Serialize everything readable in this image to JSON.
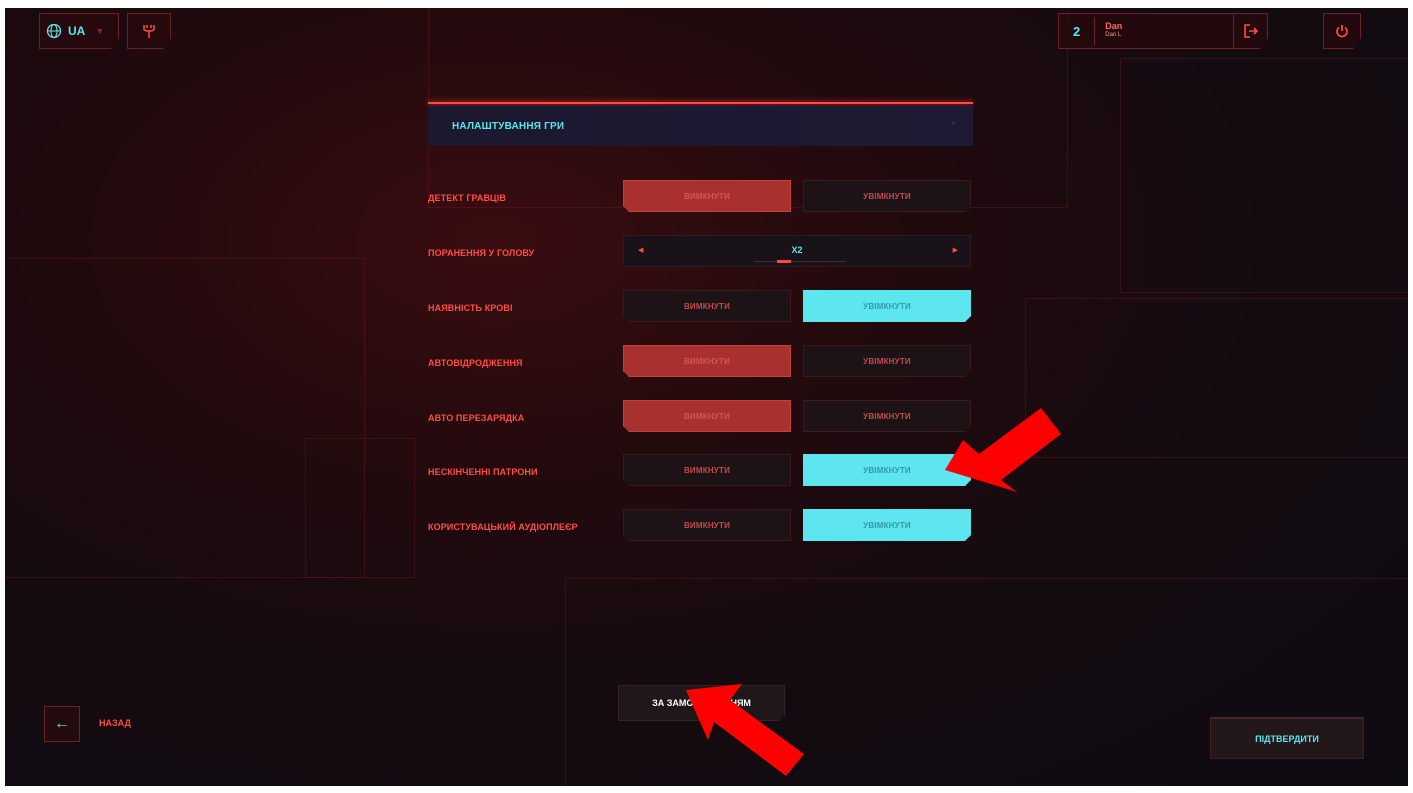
{
  "top_left": {
    "language_code": "UA"
  },
  "top_right": {
    "level": "2",
    "user_name": "Dan",
    "user_subname": "Dan L"
  },
  "section": {
    "title": "НАЛАШТУВАННЯ ГРИ"
  },
  "settings": [
    {
      "label": "ДЕТЕКТ ГРАВЦІВ",
      "off_label": "ВИМКНУТИ",
      "on_label": "УВІМКНУТИ",
      "selected": "off"
    },
    {
      "label": "ПОРАНЕННЯ У ГОЛОВУ",
      "stepper_value": "X2"
    },
    {
      "label": "НАЯВНІСТЬ КРОВІ",
      "off_label": "ВИМКНУТИ",
      "on_label": "УВІМКНУТИ",
      "selected": "on"
    },
    {
      "label": "АВТОВІДРОДЖЕННЯ",
      "off_label": "ВИМКНУТИ",
      "on_label": "УВІМКНУТИ",
      "selected": "off"
    },
    {
      "label": "АВТО ПЕРЕЗАРЯДКА",
      "off_label": "ВИМКНУТИ",
      "on_label": "УВІМКНУТИ",
      "selected": "off"
    },
    {
      "label": "НЕСКІНЧЕННІ ПАТРОНИ",
      "off_label": "ВИМКНУТИ",
      "on_label": "УВІМКНУТИ",
      "selected": "on"
    },
    {
      "label": "КОРИСТУВАЦЬКИЙ АУДІОПЛЕЄР",
      "off_label": "ВИМКНУТИ",
      "on_label": "УВІМКНУТИ",
      "selected": "on"
    }
  ],
  "footer": {
    "back_label": "НАЗАД",
    "defaults_label": "ЗА ЗАМОВЧУВАННЯМ",
    "confirm_label": "ПІДТВЕРДИТИ"
  },
  "icons": {
    "language": "globe-icon",
    "network": "antenna-icon",
    "logout": "logout-icon",
    "power": "power-icon",
    "back": "arrow-left-icon",
    "annotation": "red-arrow-icon"
  },
  "colors": {
    "accent_cyan": "#5ae6ee",
    "accent_red": "#ff4d44",
    "selected_red": "#a8302f",
    "selected_cyan": "#5de6f0",
    "annotation_red": "#ff0000"
  }
}
